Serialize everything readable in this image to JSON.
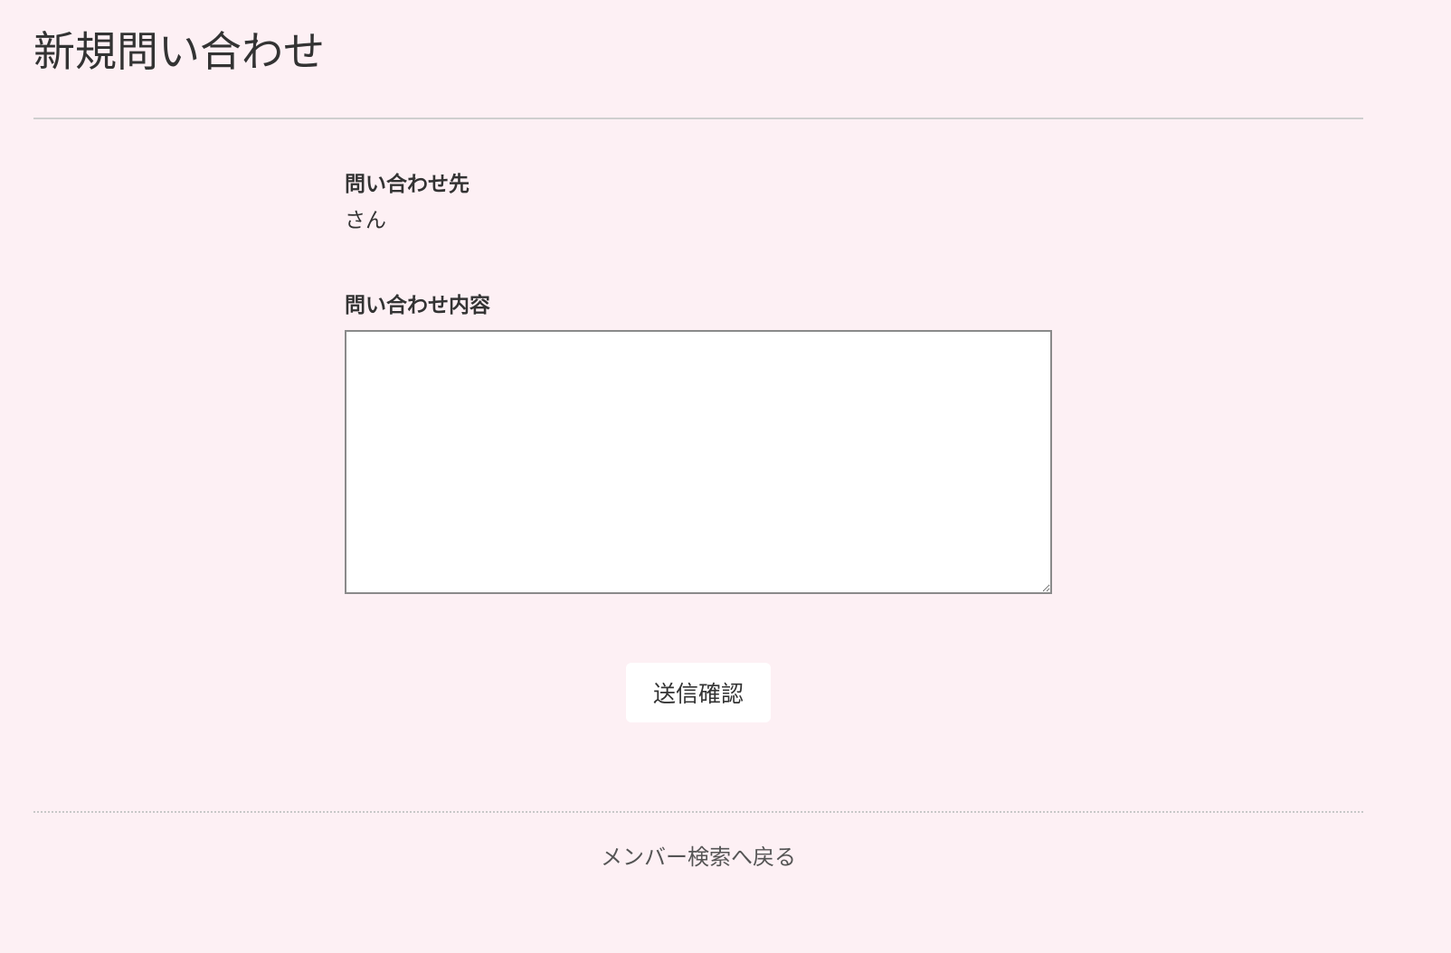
{
  "page": {
    "title": "新規問い合わせ",
    "background_color": "#fdf0f4"
  },
  "form": {
    "recipient_label": "問い合わせ先",
    "recipient_value": "さん",
    "content_label": "問い合わせ内容",
    "content_value": "",
    "submit_label": "送信確認"
  },
  "footer": {
    "back_link_label": "メンバー検索へ戻る"
  }
}
